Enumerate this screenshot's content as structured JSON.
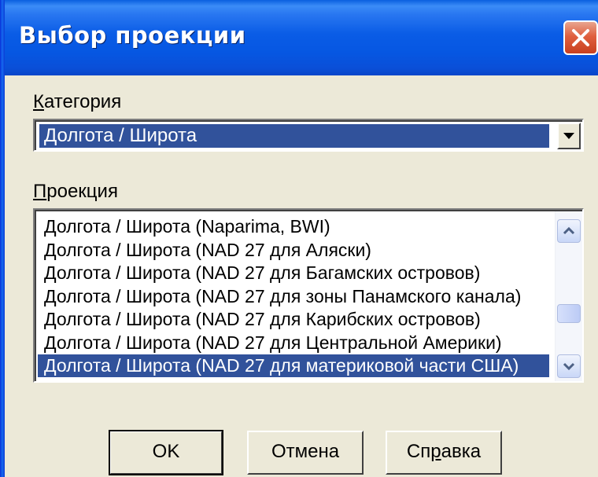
{
  "window": {
    "title": "Выбор проекции"
  },
  "category": {
    "label_accel": "К",
    "label_rest": "атегория",
    "selected": "Долгота / Широта"
  },
  "projection": {
    "label_accel": "П",
    "label_rest": "роекция",
    "items": [
      "Долгота / Широта (Naparima, BWI)",
      "Долгота / Широта (NAD 27 для Аляски)",
      "Долгота / Широта (NAD 27 для Багамских островов)",
      "Долгота / Широта (NAD 27 для зоны Панамского канала)",
      "Долгота / Широта (NAD 27 для Карибских островов)",
      "Долгота / Широта (NAD 27 для Центральной Америки)",
      "Долгота / Широта (NAD 27 для материковой части США)"
    ],
    "selected_index": 6
  },
  "buttons": {
    "ok": "OK",
    "cancel": "Отмена",
    "help_pre": "Сп",
    "help_accel": "р",
    "help_post": "авка"
  },
  "colors": {
    "titlebar": "#0a5ce6",
    "selection": "#31529b",
    "dialog_bg": "#ece9d8",
    "close_button": "#e0603f"
  },
  "icons": {
    "close": "close-x-icon",
    "combo_dropdown": "triangle-down-icon",
    "scroll_up": "chevron-up-icon",
    "scroll_down": "chevron-down-icon"
  }
}
